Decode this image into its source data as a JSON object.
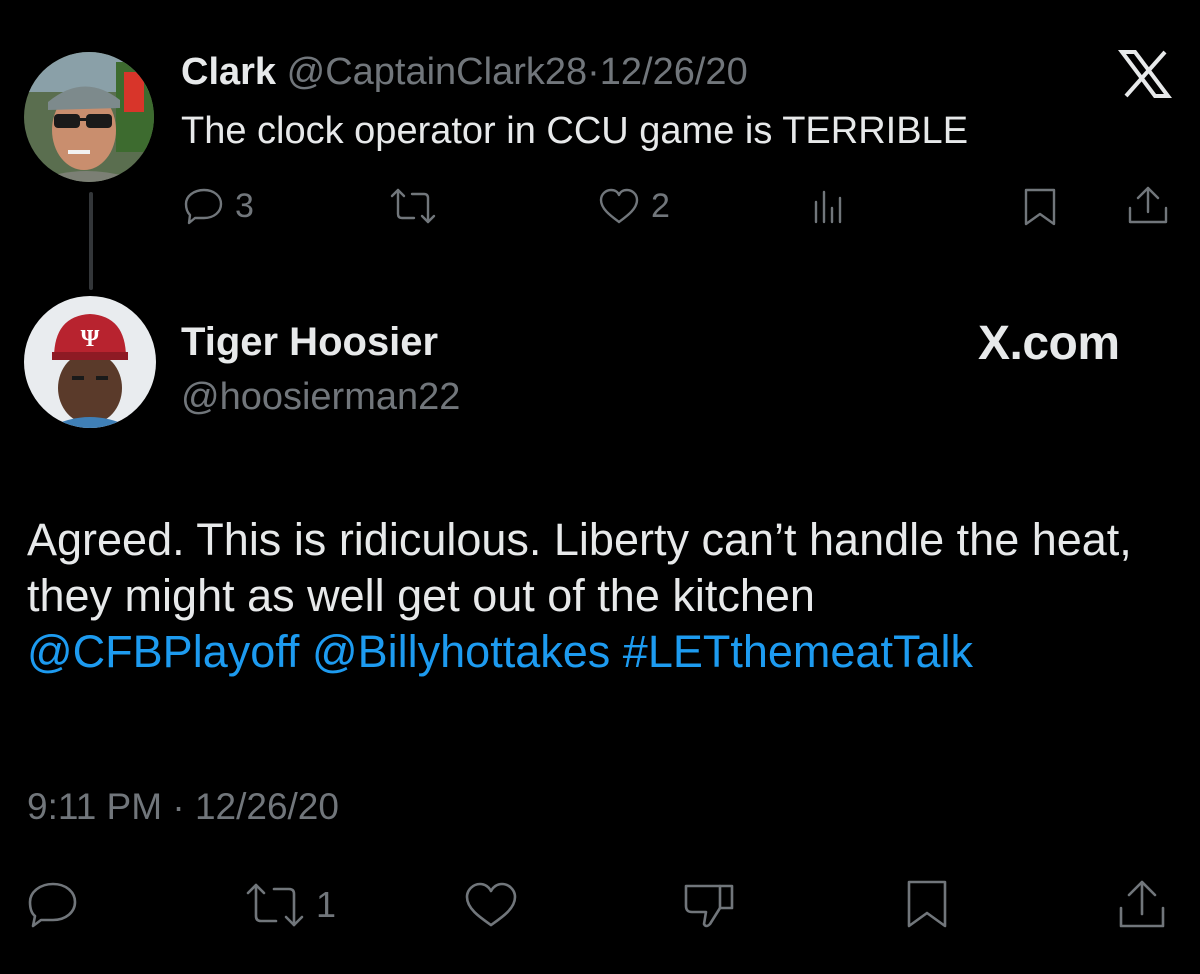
{
  "parent_tweet": {
    "author_name": "Clark",
    "handle": "@CaptainClark28",
    "separator": "·",
    "date": "12/26/20",
    "text": "The clock operator in CCU game is TERRIBLE",
    "reply_count": "3",
    "like_count": "2",
    "icons": [
      "reply-icon",
      "retweet-icon",
      "like-icon",
      "views-icon",
      "bookmark-icon",
      "share-icon"
    ]
  },
  "reply_tweet": {
    "author_name": "Tiger Hoosier",
    "handle": "@hoosierman22",
    "brand_label": "X.com",
    "body_text": "Agreed. This is ridiculous. Liberty can’t handle the heat, they might as well get out of the kitchen",
    "mentions": [
      "@CFBPlayoff",
      "@Billyhottakes",
      "#LETthemeatTalk"
    ],
    "time": "9:11 PM",
    "separator": "·",
    "date": "12/26/20",
    "retweet_count": "1",
    "icons": [
      "reply-icon",
      "retweet-icon",
      "like-icon",
      "dislike-icon",
      "bookmark-icon",
      "share-icon"
    ]
  },
  "colors": {
    "background": "#000000",
    "text": "#e7e9ea",
    "muted": "#71767b",
    "link": "#1d9bf0",
    "cap_red": "#b8232f"
  }
}
